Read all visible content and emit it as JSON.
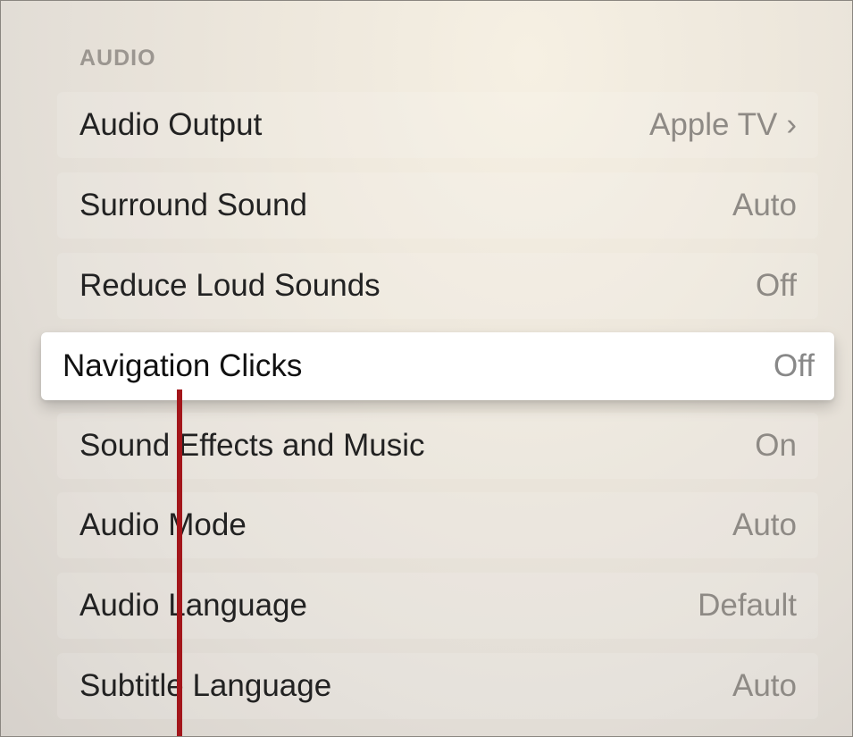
{
  "section": {
    "title": "AUDIO"
  },
  "rows": [
    {
      "label": "Audio Output",
      "value": "Apple TV",
      "chevron": "›"
    },
    {
      "label": "Surround Sound",
      "value": "Auto"
    },
    {
      "label": "Reduce Loud Sounds",
      "value": "Off"
    },
    {
      "label": "Navigation Clicks",
      "value": "Off"
    },
    {
      "label": "Sound Effects and Music",
      "value": "On"
    },
    {
      "label": "Audio Mode",
      "value": "Auto"
    },
    {
      "label": "Audio Language",
      "value": "Default"
    },
    {
      "label": "Subtitle Language",
      "value": "Auto"
    }
  ],
  "focused_row": "Navigation Clicks",
  "icons": {
    "chevron": "chevron-right-icon"
  },
  "colors": {
    "marker": "#a3161b",
    "focused_background": "#ffffff"
  }
}
